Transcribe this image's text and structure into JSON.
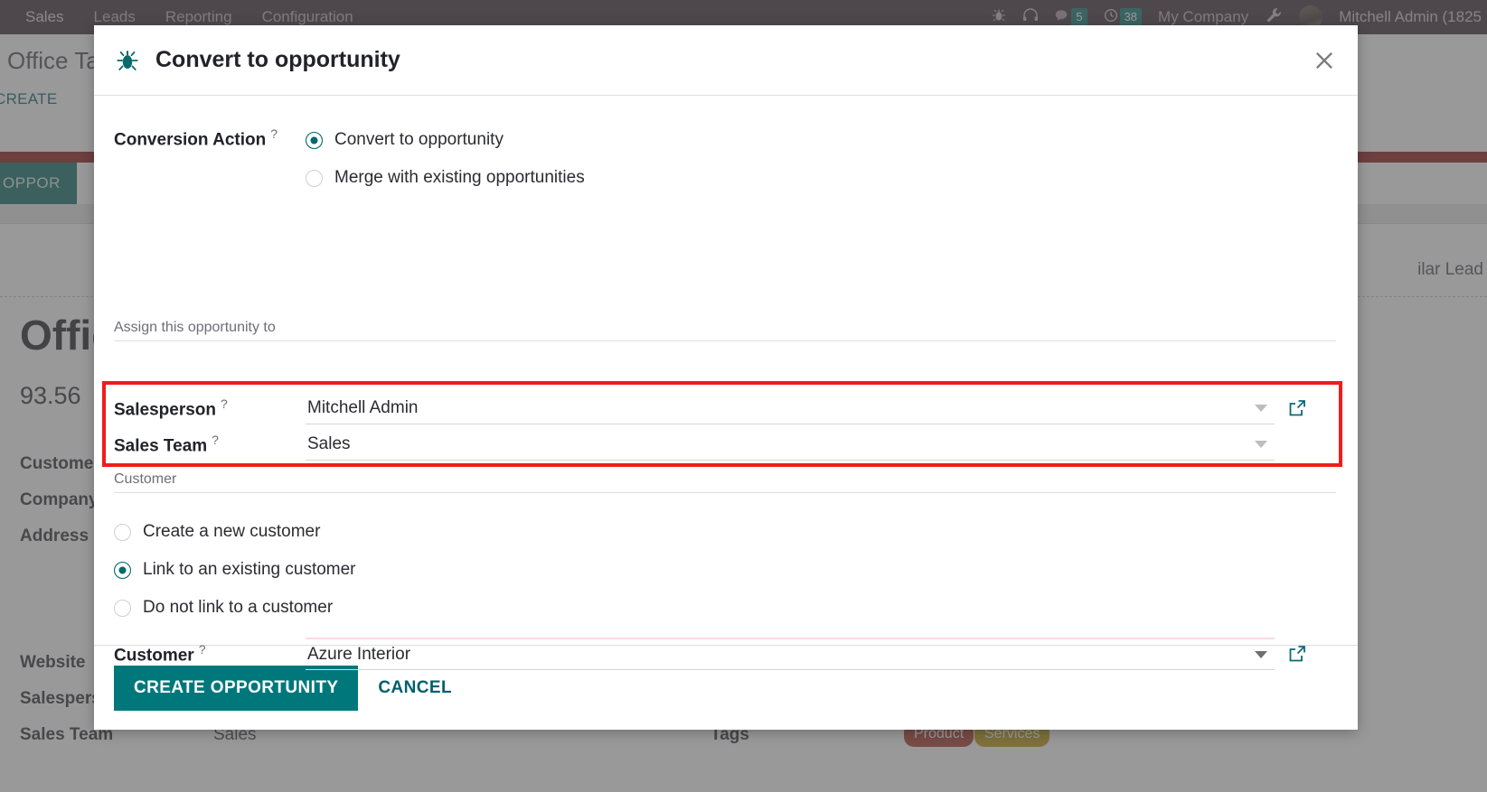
{
  "topbar": {
    "menus": [
      {
        "label": "Sales",
        "active": true
      },
      {
        "label": "Leads",
        "active": false
      },
      {
        "label": "Reporting",
        "active": false
      },
      {
        "label": "Configuration",
        "active": false
      }
    ],
    "bug_icon": "bug-icon",
    "support_icon": "headset-icon",
    "messages_icon": "chat-icon",
    "messages_count": "5",
    "activities_icon": "clock-icon",
    "activities_count": "38",
    "company": "My Company",
    "tools_icon": "wrench-icon",
    "user": "Mitchell Admin (1825"
  },
  "background": {
    "breadcrumb": "Office Ta",
    "create_button": "CREATE",
    "convert_button": "T TO OPPOR",
    "similar_leads": "ilar Lead",
    "record_title": "Offic",
    "record_subtitle": "93.56",
    "fields": [
      {
        "label": "Customer",
        "value": ""
      },
      {
        "label": "Company",
        "value": ""
      },
      {
        "label": "Address",
        "value": ""
      },
      {
        "label": "Website",
        "value": ""
      },
      {
        "label": "Salespers",
        "value": ""
      },
      {
        "label": "Sales Team",
        "value": "Sales"
      }
    ],
    "tags_label": "Tags",
    "tags": [
      {
        "label": "Product",
        "color": "#a93226"
      },
      {
        "label": "Services",
        "color": "#b7960d"
      }
    ]
  },
  "modal": {
    "icon": "bug-icon",
    "title": "Convert to opportunity",
    "close_icon": "close-icon",
    "conversion_action": {
      "label": "Conversion Action",
      "help": "?",
      "options": [
        {
          "label": "Convert to opportunity",
          "selected": true
        },
        {
          "label": "Merge with existing opportunities",
          "selected": false
        }
      ]
    },
    "assign_section": {
      "title": "Assign this opportunity to",
      "fields": [
        {
          "label": "Salesperson",
          "help": "?",
          "value": "Mitchell Admin",
          "has_caret": true,
          "has_external_link": true
        },
        {
          "label": "Sales Team",
          "help": "?",
          "value": "Sales",
          "has_caret": true,
          "has_external_link": false
        }
      ]
    },
    "customer_section": {
      "title": "Customer",
      "options": [
        {
          "label": "Create a new customer",
          "selected": false
        },
        {
          "label": "Link to an existing customer",
          "selected": true
        },
        {
          "label": "Do not link to a customer",
          "selected": false
        }
      ],
      "field": {
        "label": "Customer",
        "help": "?",
        "value": "Azure Interior",
        "has_caret": true,
        "has_external_link": true
      }
    },
    "footer": {
      "primary_label": "CREATE OPPORTUNITY",
      "cancel_label": "CANCEL"
    }
  },
  "colors": {
    "accent": "#00787b",
    "topbar": "#3a2b38",
    "badge": "#0a7471",
    "highlight": "#f01c1c",
    "status_red": "#8b1414"
  }
}
